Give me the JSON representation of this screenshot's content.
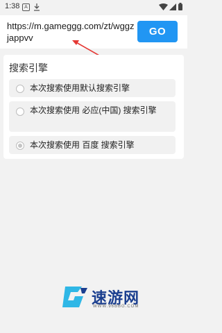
{
  "status_bar": {
    "time": "1:38",
    "app_icon_letter": "A",
    "icons": [
      "app-icon",
      "download-icon",
      "wifi-icon",
      "signal-icon",
      "battery-icon"
    ]
  },
  "url_bar": {
    "url": "https://m.gameggg.com/zt/wggzjappvv",
    "go_label": "GO"
  },
  "search_engine": {
    "title": "搜索引擎",
    "options": [
      {
        "label": "本次搜索使用默认搜索引擎",
        "checked": false
      },
      {
        "label": "本次搜索使用 必应(中国) 搜索引擎",
        "checked": false
      },
      {
        "label": "本次搜索使用 百度 搜索引擎",
        "checked": true
      }
    ]
  },
  "watermark": {
    "name": "速游网",
    "domain": "WWW.96BBG.COM"
  },
  "colors": {
    "accent": "#2196f3",
    "annotation": "#e53935",
    "background": "#f2f2f2",
    "watermark_blue": "#1b3f8f",
    "watermark_cyan": "#2fb7e6"
  }
}
